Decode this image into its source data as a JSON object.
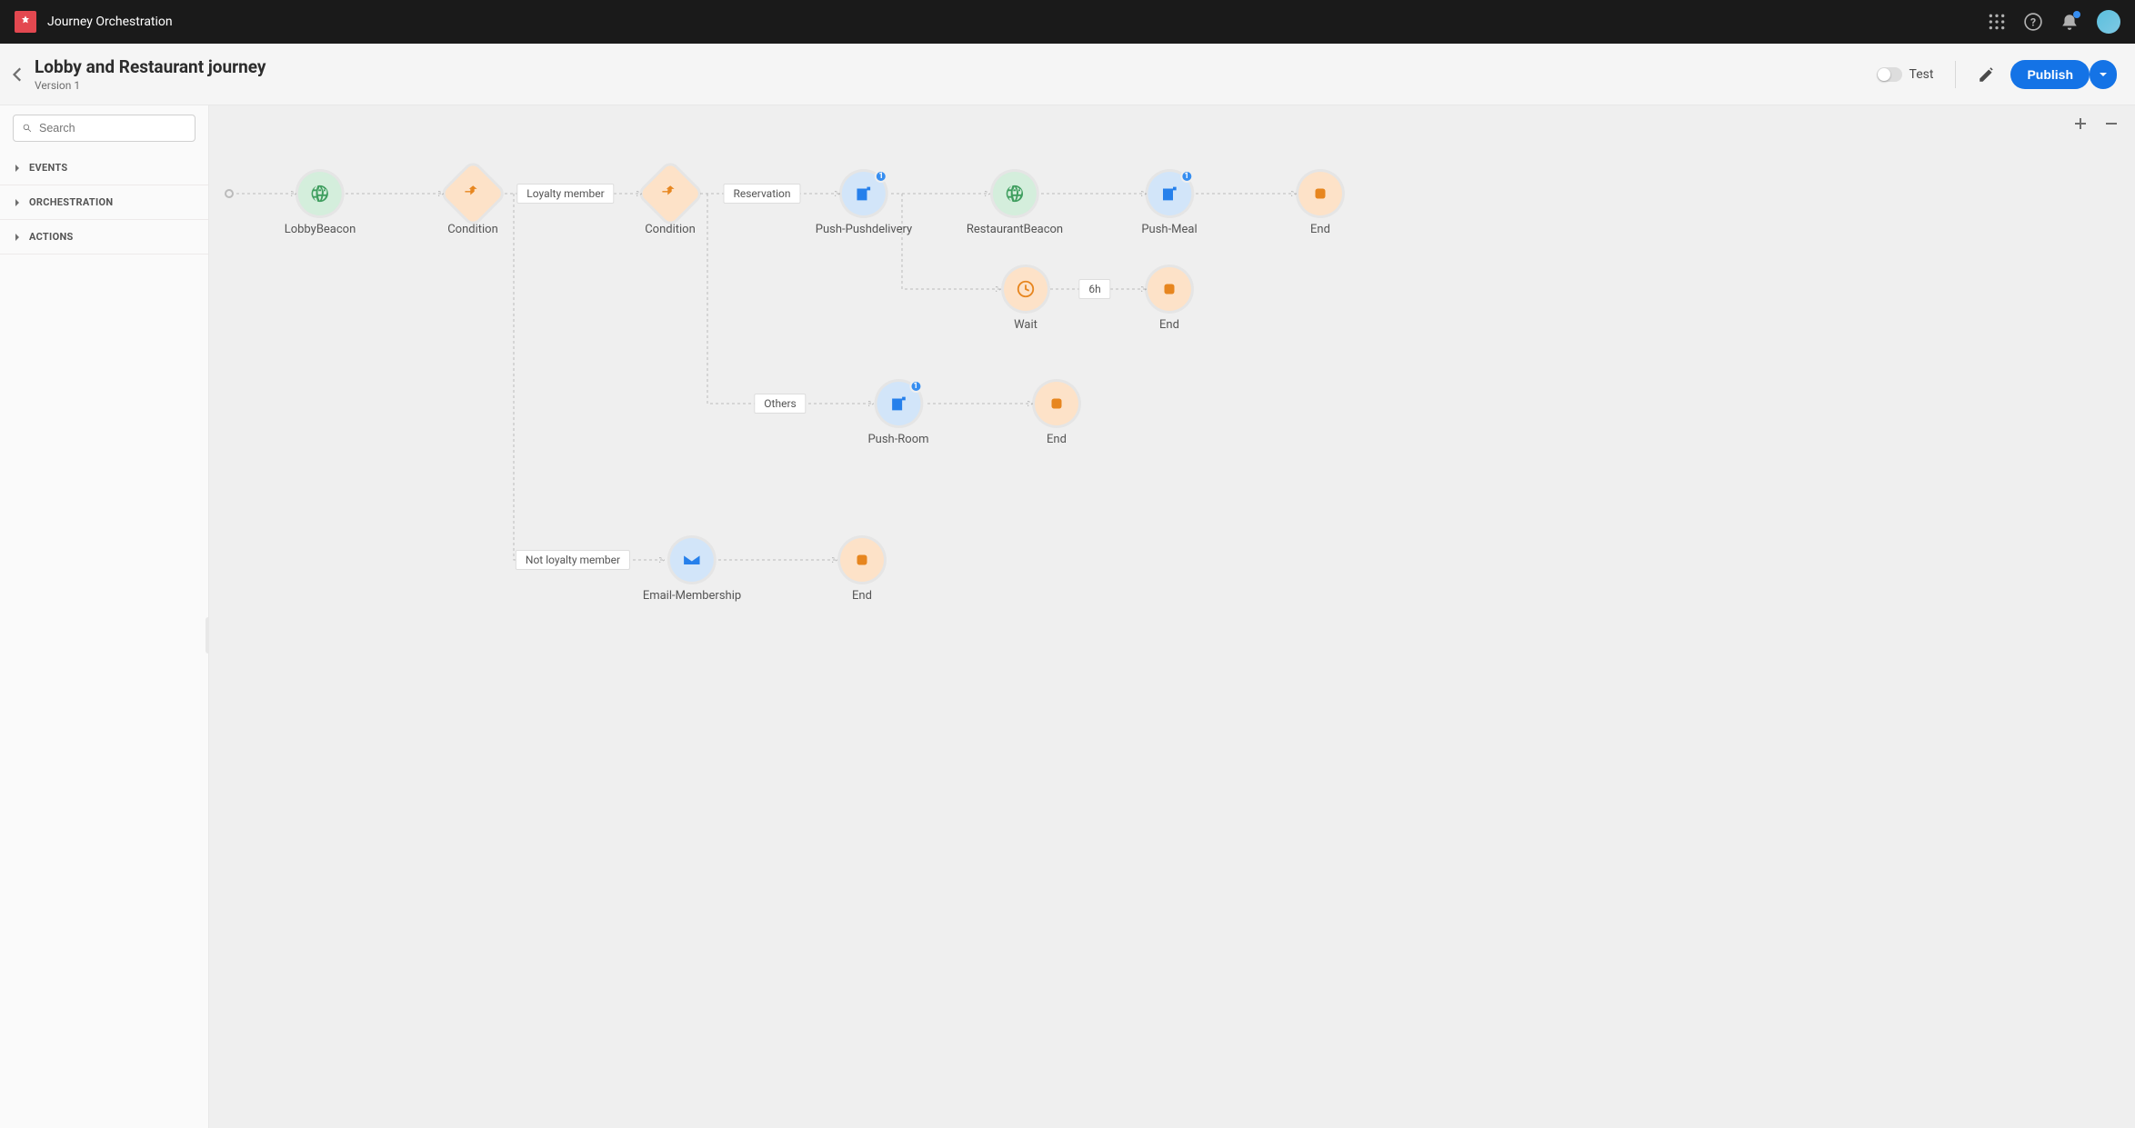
{
  "app": {
    "name": "Journey Orchestration"
  },
  "journey": {
    "title": "Lobby and Restaurant journey",
    "version": "Version 1"
  },
  "actions": {
    "test_label": "Test",
    "publish_label": "Publish"
  },
  "sidebar": {
    "search_placeholder": "Search",
    "categories": [
      "EVENTS",
      "ORCHESTRATION",
      "ACTIONS"
    ]
  },
  "nodes": {
    "lobby_beacon": {
      "label": "LobbyBeacon"
    },
    "condition1": {
      "label": "Condition"
    },
    "condition2": {
      "label": "Condition"
    },
    "push_delivery": {
      "label": "Push-Pushdelivery",
      "badge": "1"
    },
    "restaurant_beacon": {
      "label": "RestaurantBeacon"
    },
    "push_meal": {
      "label": "Push-Meal",
      "badge": "1"
    },
    "end1": {
      "label": "End"
    },
    "wait": {
      "label": "Wait"
    },
    "end2": {
      "label": "End"
    },
    "push_room": {
      "label": "Push-Room",
      "badge": "1"
    },
    "end3": {
      "label": "End"
    },
    "email_membership": {
      "label": "Email-Membership"
    },
    "end4": {
      "label": "End"
    }
  },
  "paths": {
    "loyalty": "Loyalty member",
    "not_loyalty": "Not loyalty member",
    "reservation": "Reservation",
    "others": "Others",
    "wait_time": "6h"
  }
}
